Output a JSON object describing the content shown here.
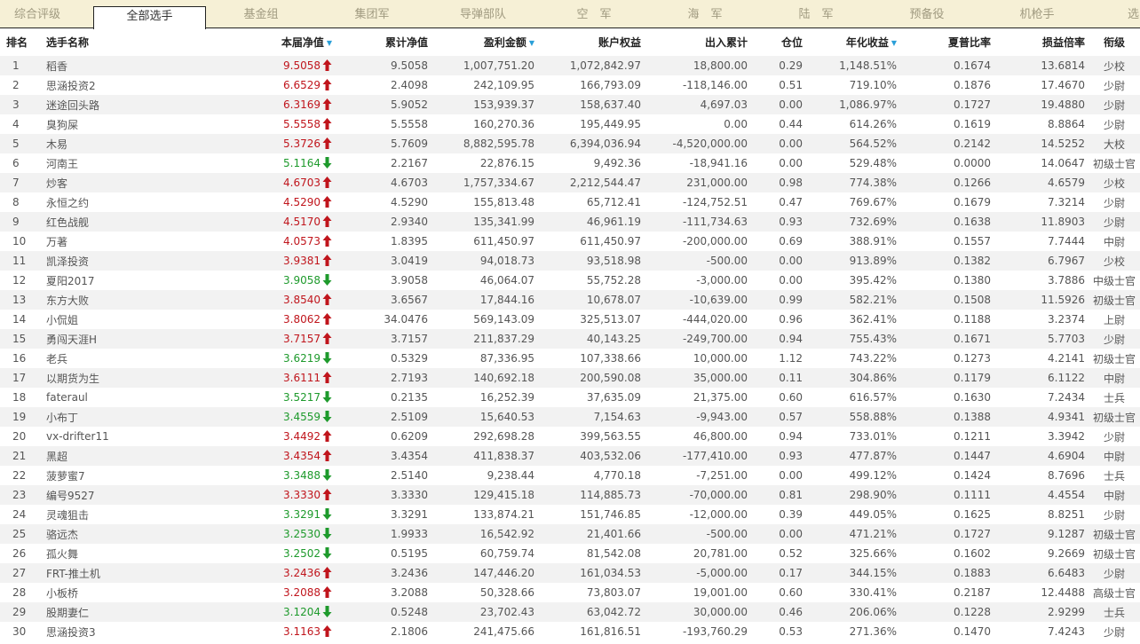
{
  "tabs": [
    {
      "label": "综合评级",
      "active": false
    },
    {
      "label": "全部选手",
      "active": true
    },
    {
      "label": "基金组",
      "active": false
    },
    {
      "label": "集团军",
      "active": false
    },
    {
      "label": "导弹部队",
      "active": false
    },
    {
      "label": "空　军",
      "active": false
    },
    {
      "label": "海　军",
      "active": false
    },
    {
      "label": "陆　军",
      "active": false
    },
    {
      "label": "预备役",
      "active": false
    },
    {
      "label": "机枪手",
      "active": false
    },
    {
      "label": "选",
      "active": false
    }
  ],
  "columns": [
    {
      "key": "rank",
      "label": "排名",
      "sortable": false
    },
    {
      "key": "name",
      "label": "选手名称",
      "sortable": false
    },
    {
      "key": "nav",
      "label": "本届净值",
      "sortable": true
    },
    {
      "key": "cum_nav",
      "label": "累计净值",
      "sortable": false
    },
    {
      "key": "profit",
      "label": "盈利金额",
      "sortable": true
    },
    {
      "key": "equity",
      "label": "账户权益",
      "sortable": false
    },
    {
      "key": "flow",
      "label": "出入累计",
      "sortable": false
    },
    {
      "key": "position",
      "label": "仓位",
      "sortable": false
    },
    {
      "key": "annual",
      "label": "年化收益",
      "sortable": true
    },
    {
      "key": "sharpe",
      "label": "夏普比率",
      "sortable": false
    },
    {
      "key": "pl_ratio",
      "label": "损益倍率",
      "sortable": false
    },
    {
      "key": "level",
      "label": "衔级",
      "sortable": false
    }
  ],
  "colors": {
    "up": "#c0151c",
    "down": "#1e9a2c",
    "sort_indicator": "#2a9fd8",
    "tab_bar_bg": "#f6f0d6",
    "row_stripe": "#f2f2f2"
  },
  "rows": [
    {
      "rank": "1",
      "name": "稻香",
      "nav": "9.5058",
      "dir": "up",
      "cum_nav": "9.5058",
      "profit": "1,007,751.20",
      "equity": "1,072,842.97",
      "flow": "18,800.00",
      "position": "0.29",
      "annual": "1,148.51%",
      "sharpe": "0.1674",
      "pl_ratio": "13.6814",
      "level": "少校"
    },
    {
      "rank": "2",
      "name": "思涵投资2",
      "nav": "6.6529",
      "dir": "up",
      "cum_nav": "2.4098",
      "profit": "242,109.95",
      "equity": "166,793.09",
      "flow": "-118,146.00",
      "position": "0.51",
      "annual": "719.10%",
      "sharpe": "0.1876",
      "pl_ratio": "17.4670",
      "level": "少尉"
    },
    {
      "rank": "3",
      "name": "迷途回头路",
      "nav": "6.3169",
      "dir": "up",
      "cum_nav": "5.9052",
      "profit": "153,939.37",
      "equity": "158,637.40",
      "flow": "4,697.03",
      "position": "0.00",
      "annual": "1,086.97%",
      "sharpe": "0.1727",
      "pl_ratio": "19.4880",
      "level": "少尉"
    },
    {
      "rank": "4",
      "name": "臭狗屎",
      "nav": "5.5558",
      "dir": "up",
      "cum_nav": "5.5558",
      "profit": "160,270.36",
      "equity": "195,449.95",
      "flow": "0.00",
      "position": "0.44",
      "annual": "614.26%",
      "sharpe": "0.1619",
      "pl_ratio": "8.8864",
      "level": "少尉"
    },
    {
      "rank": "5",
      "name": "木易",
      "nav": "5.3726",
      "dir": "up",
      "cum_nav": "5.7609",
      "profit": "8,882,595.78",
      "equity": "6,394,036.94",
      "flow": "-4,520,000.00",
      "position": "0.00",
      "annual": "564.52%",
      "sharpe": "0.2142",
      "pl_ratio": "14.5252",
      "level": "大校"
    },
    {
      "rank": "6",
      "name": "河南王",
      "nav": "5.1164",
      "dir": "down",
      "cum_nav": "2.2167",
      "profit": "22,876.15",
      "equity": "9,492.36",
      "flow": "-18,941.16",
      "position": "0.00",
      "annual": "529.48%",
      "sharpe": "0.0000",
      "pl_ratio": "14.0647",
      "level": "初级士官"
    },
    {
      "rank": "7",
      "name": "炒客",
      "nav": "4.6703",
      "dir": "up",
      "cum_nav": "4.6703",
      "profit": "1,757,334.67",
      "equity": "2,212,544.47",
      "flow": "231,000.00",
      "position": "0.98",
      "annual": "774.38%",
      "sharpe": "0.1266",
      "pl_ratio": "4.6579",
      "level": "少校"
    },
    {
      "rank": "8",
      "name": "永恒之约",
      "nav": "4.5290",
      "dir": "up",
      "cum_nav": "4.5290",
      "profit": "155,813.48",
      "equity": "65,712.41",
      "flow": "-124,752.51",
      "position": "0.47",
      "annual": "769.67%",
      "sharpe": "0.1679",
      "pl_ratio": "7.3214",
      "level": "少尉"
    },
    {
      "rank": "9",
      "name": "红色战舰",
      "nav": "4.5170",
      "dir": "up",
      "cum_nav": "2.9340",
      "profit": "135,341.99",
      "equity": "46,961.19",
      "flow": "-111,734.63",
      "position": "0.93",
      "annual": "732.69%",
      "sharpe": "0.1638",
      "pl_ratio": "11.8903",
      "level": "少尉"
    },
    {
      "rank": "10",
      "name": "万著",
      "nav": "4.0573",
      "dir": "up",
      "cum_nav": "1.8395",
      "profit": "611,450.97",
      "equity": "611,450.97",
      "flow": "-200,000.00",
      "position": "0.69",
      "annual": "388.91%",
      "sharpe": "0.1557",
      "pl_ratio": "7.7444",
      "level": "中尉"
    },
    {
      "rank": "11",
      "name": "凯泽投资",
      "nav": "3.9381",
      "dir": "up",
      "cum_nav": "3.0419",
      "profit": "94,018.73",
      "equity": "93,518.98",
      "flow": "-500.00",
      "position": "0.00",
      "annual": "913.89%",
      "sharpe": "0.1382",
      "pl_ratio": "6.7967",
      "level": "少校"
    },
    {
      "rank": "12",
      "name": "夏阳2017",
      "nav": "3.9058",
      "dir": "down",
      "cum_nav": "3.9058",
      "profit": "46,064.07",
      "equity": "55,752.28",
      "flow": "-3,000.00",
      "position": "0.00",
      "annual": "395.42%",
      "sharpe": "0.1380",
      "pl_ratio": "3.7886",
      "level": "中级士官"
    },
    {
      "rank": "13",
      "name": "东方大败",
      "nav": "3.8540",
      "dir": "up",
      "cum_nav": "3.6567",
      "profit": "17,844.16",
      "equity": "10,678.07",
      "flow": "-10,639.00",
      "position": "0.99",
      "annual": "582.21%",
      "sharpe": "0.1508",
      "pl_ratio": "11.5926",
      "level": "初级士官"
    },
    {
      "rank": "14",
      "name": "小侃姐",
      "nav": "3.8062",
      "dir": "up",
      "cum_nav": "34.0476",
      "profit": "569,143.09",
      "equity": "325,513.07",
      "flow": "-444,020.00",
      "position": "0.96",
      "annual": "362.41%",
      "sharpe": "0.1188",
      "pl_ratio": "3.2374",
      "level": "上尉"
    },
    {
      "rank": "15",
      "name": "勇闯天涯H",
      "nav": "3.7157",
      "dir": "up",
      "cum_nav": "3.7157",
      "profit": "211,837.29",
      "equity": "40,143.25",
      "flow": "-249,700.00",
      "position": "0.94",
      "annual": "755.43%",
      "sharpe": "0.1671",
      "pl_ratio": "5.7703",
      "level": "少尉"
    },
    {
      "rank": "16",
      "name": "老兵",
      "nav": "3.6219",
      "dir": "down",
      "cum_nav": "0.5329",
      "profit": "87,336.95",
      "equity": "107,338.66",
      "flow": "10,000.00",
      "position": "1.12",
      "annual": "743.22%",
      "sharpe": "0.1273",
      "pl_ratio": "4.2141",
      "level": "初级士官"
    },
    {
      "rank": "17",
      "name": "以期货为生",
      "nav": "3.6111",
      "dir": "up",
      "cum_nav": "2.7193",
      "profit": "140,692.18",
      "equity": "200,590.08",
      "flow": "35,000.00",
      "position": "0.11",
      "annual": "304.86%",
      "sharpe": "0.1179",
      "pl_ratio": "6.1122",
      "level": "中尉"
    },
    {
      "rank": "18",
      "name": "fateraul",
      "nav": "3.5217",
      "dir": "down",
      "cum_nav": "0.2135",
      "profit": "16,252.39",
      "equity": "37,635.09",
      "flow": "21,375.00",
      "position": "0.60",
      "annual": "616.57%",
      "sharpe": "0.1630",
      "pl_ratio": "7.2434",
      "level": "士兵"
    },
    {
      "rank": "19",
      "name": "小布丁",
      "nav": "3.4559",
      "dir": "down",
      "cum_nav": "2.5109",
      "profit": "15,640.53",
      "equity": "7,154.63",
      "flow": "-9,943.00",
      "position": "0.57",
      "annual": "558.88%",
      "sharpe": "0.1388",
      "pl_ratio": "4.9341",
      "level": "初级士官"
    },
    {
      "rank": "20",
      "name": "vx-drifter11",
      "nav": "3.4492",
      "dir": "up",
      "cum_nav": "0.6209",
      "profit": "292,698.28",
      "equity": "399,563.55",
      "flow": "46,800.00",
      "position": "0.94",
      "annual": "733.01%",
      "sharpe": "0.1211",
      "pl_ratio": "3.3942",
      "level": "少尉"
    },
    {
      "rank": "21",
      "name": "黑超",
      "nav": "3.4354",
      "dir": "up",
      "cum_nav": "3.4354",
      "profit": "411,838.37",
      "equity": "403,532.06",
      "flow": "-177,410.00",
      "position": "0.93",
      "annual": "477.87%",
      "sharpe": "0.1447",
      "pl_ratio": "4.6904",
      "level": "中尉"
    },
    {
      "rank": "22",
      "name": "菠萝蜜7",
      "nav": "3.3488",
      "dir": "down",
      "cum_nav": "2.5140",
      "profit": "9,238.44",
      "equity": "4,770.18",
      "flow": "-7,251.00",
      "position": "0.00",
      "annual": "499.12%",
      "sharpe": "0.1424",
      "pl_ratio": "8.7696",
      "level": "士兵"
    },
    {
      "rank": "23",
      "name": "编号9527",
      "nav": "3.3330",
      "dir": "up",
      "cum_nav": "3.3330",
      "profit": "129,415.18",
      "equity": "114,885.73",
      "flow": "-70,000.00",
      "position": "0.81",
      "annual": "298.90%",
      "sharpe": "0.1111",
      "pl_ratio": "4.4554",
      "level": "中尉"
    },
    {
      "rank": "24",
      "name": "灵魂狙击",
      "nav": "3.3291",
      "dir": "down",
      "cum_nav": "3.3291",
      "profit": "133,874.21",
      "equity": "151,746.85",
      "flow": "-12,000.00",
      "position": "0.39",
      "annual": "449.05%",
      "sharpe": "0.1625",
      "pl_ratio": "8.8251",
      "level": "少尉"
    },
    {
      "rank": "25",
      "name": "骆远杰",
      "nav": "3.2530",
      "dir": "down",
      "cum_nav": "1.9933",
      "profit": "16,542.92",
      "equity": "21,401.66",
      "flow": "-500.00",
      "position": "0.00",
      "annual": "471.21%",
      "sharpe": "0.1727",
      "pl_ratio": "9.1287",
      "level": "初级士官"
    },
    {
      "rank": "26",
      "name": "孤火舞",
      "nav": "3.2502",
      "dir": "down",
      "cum_nav": "0.5195",
      "profit": "60,759.74",
      "equity": "81,542.08",
      "flow": "20,781.00",
      "position": "0.52",
      "annual": "325.66%",
      "sharpe": "0.1602",
      "pl_ratio": "9.2669",
      "level": "初级士官"
    },
    {
      "rank": "27",
      "name": "FRT-推土机",
      "nav": "3.2436",
      "dir": "up",
      "cum_nav": "3.2436",
      "profit": "147,446.20",
      "equity": "161,034.53",
      "flow": "-5,000.00",
      "position": "0.17",
      "annual": "344.15%",
      "sharpe": "0.1883",
      "pl_ratio": "6.6483",
      "level": "少尉"
    },
    {
      "rank": "28",
      "name": "小板桥",
      "nav": "3.2088",
      "dir": "up",
      "cum_nav": "3.2088",
      "profit": "50,328.66",
      "equity": "73,803.07",
      "flow": "19,001.00",
      "position": "0.60",
      "annual": "330.41%",
      "sharpe": "0.2187",
      "pl_ratio": "12.4488",
      "level": "高级士官"
    },
    {
      "rank": "29",
      "name": "股期妻仁",
      "nav": "3.1204",
      "dir": "down",
      "cum_nav": "0.5248",
      "profit": "23,702.43",
      "equity": "63,042.72",
      "flow": "30,000.00",
      "position": "0.46",
      "annual": "206.06%",
      "sharpe": "0.1228",
      "pl_ratio": "2.9299",
      "level": "士兵"
    },
    {
      "rank": "30",
      "name": "思涵投资3",
      "nav": "3.1163",
      "dir": "up",
      "cum_nav": "2.1806",
      "profit": "241,475.66",
      "equity": "161,816.51",
      "flow": "-193,760.29",
      "position": "0.53",
      "annual": "271.36%",
      "sharpe": "0.1470",
      "pl_ratio": "7.4243",
      "level": "少尉"
    }
  ]
}
